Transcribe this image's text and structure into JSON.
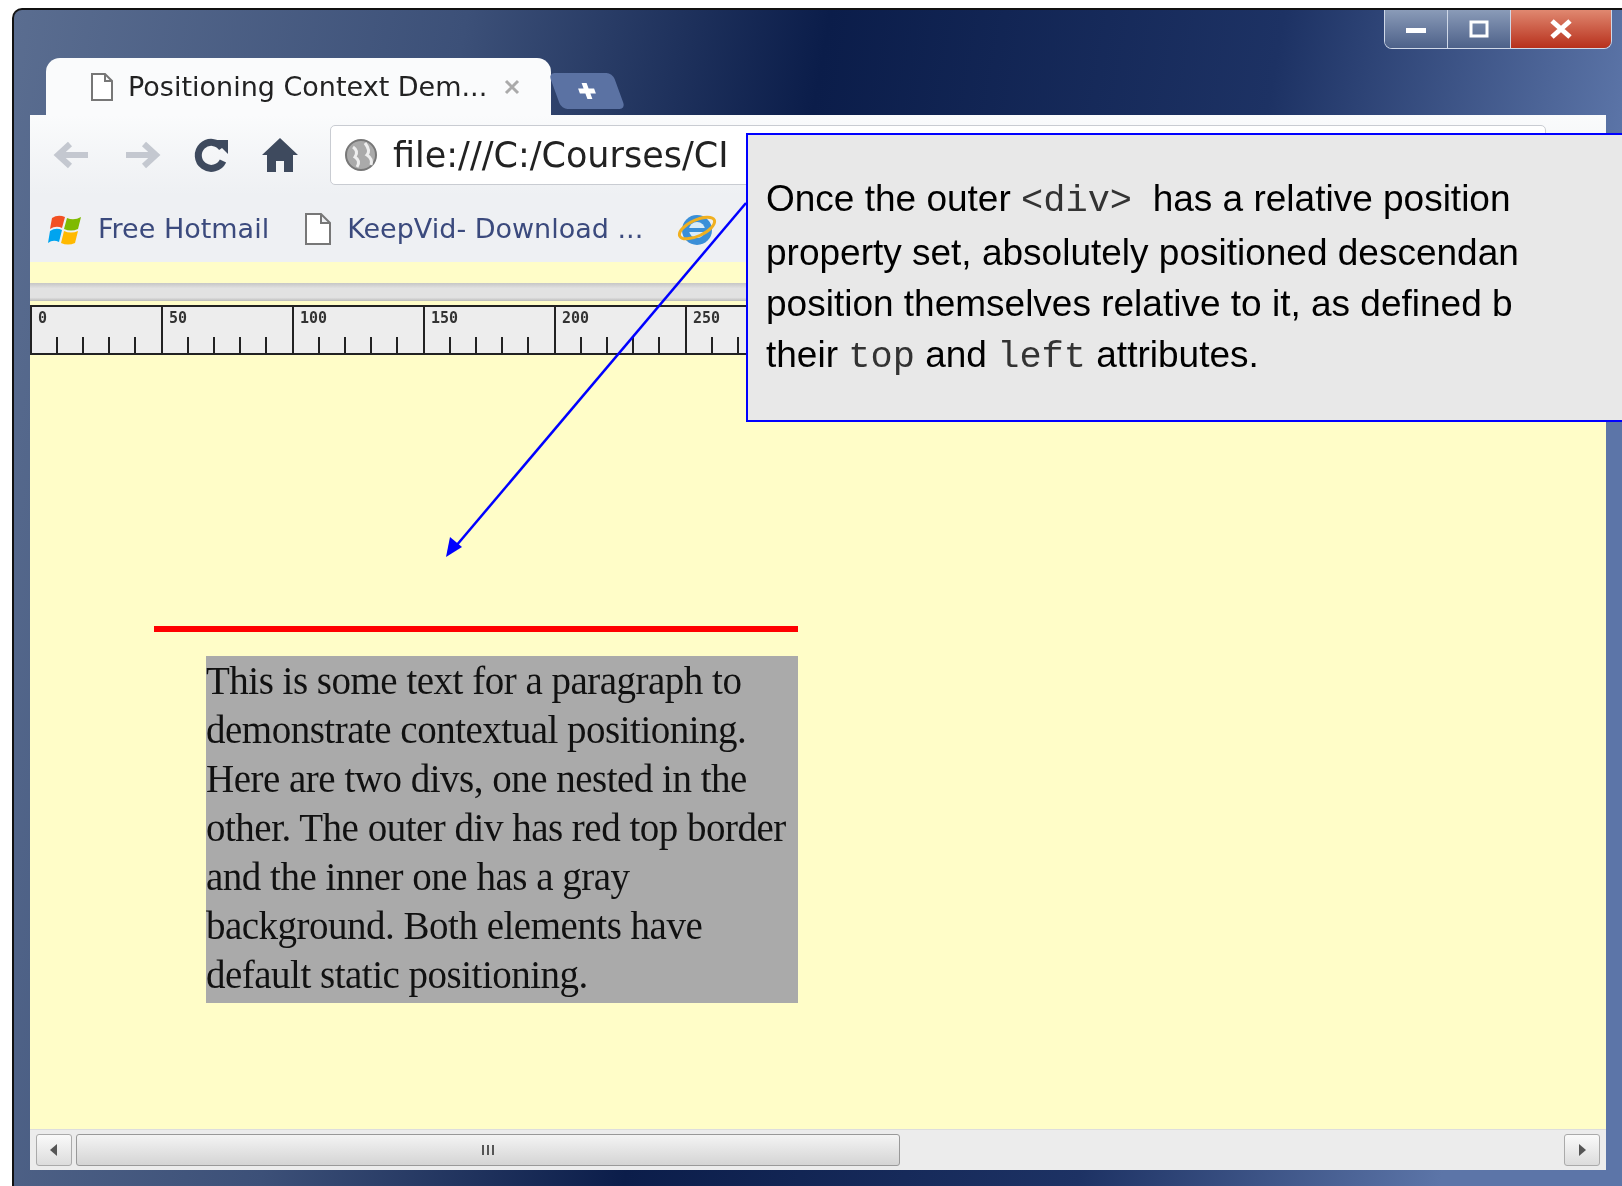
{
  "tabs": [
    {
      "title": "Positioning Context Dem...",
      "selected": true
    }
  ],
  "toolbar": {
    "address": "file:///C:/Courses/CI"
  },
  "bookmarks": [
    {
      "kind": "flag",
      "label": "Free Hotmail"
    },
    {
      "kind": "page",
      "label": "KeepVid- Download ..."
    },
    {
      "kind": "globe"
    }
  ],
  "ruler": {
    "labels": [
      "0",
      "50",
      "100",
      "150",
      "200",
      "250"
    ]
  },
  "page": {
    "paragraph": "This is some text for a paragraph to demonstrate contextual positioning. Here are two divs, one nested in the other. The outer div has red top border and the inner one has a gray background. Both elements have default static positioning."
  },
  "callout": {
    "lines": [
      [
        {
          "kind": "text",
          "text": "Once the outer "
        },
        {
          "kind": "code",
          "text": "<div>"
        },
        {
          "kind": "text",
          "text": "  has a relative position"
        }
      ],
      [
        {
          "kind": "text",
          "text": "property set, absolutely positioned descendan"
        }
      ],
      [
        {
          "kind": "text",
          "text": "position themselves relative to it, as defined b"
        }
      ],
      [
        {
          "kind": "text",
          "text": "their "
        },
        {
          "kind": "code",
          "text": "top"
        },
        {
          "kind": "text",
          "text": " and "
        },
        {
          "kind": "code",
          "text": "left"
        },
        {
          "kind": "text",
          "text": " attributes."
        }
      ]
    ]
  }
}
